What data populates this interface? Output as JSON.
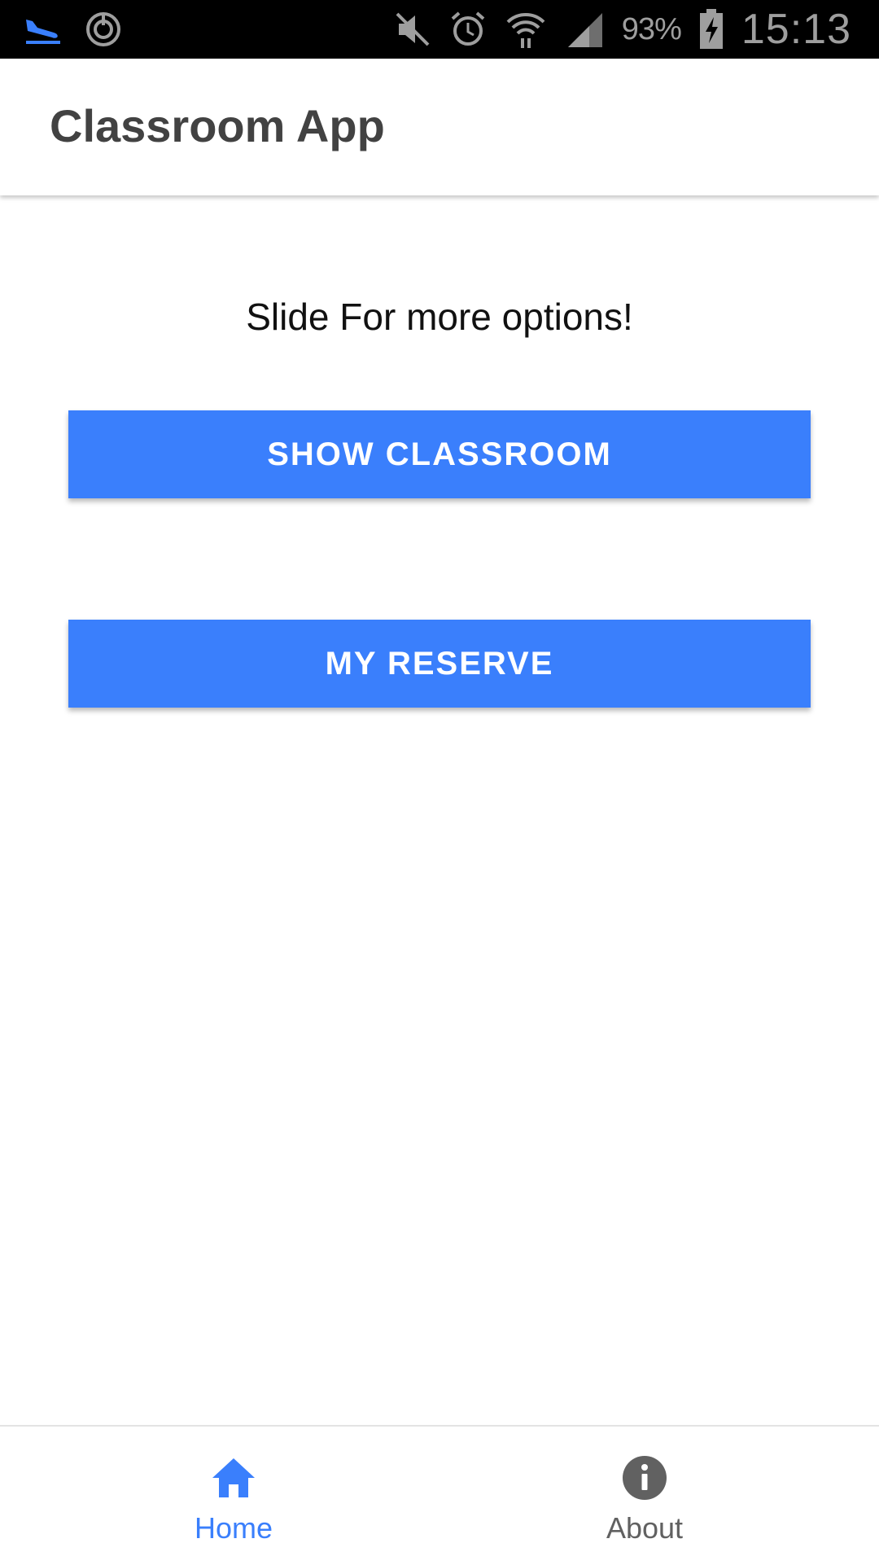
{
  "status_bar": {
    "battery_percent": "93%",
    "time": "15:13",
    "icons": [
      "airplane-landing-icon",
      "sync-icon",
      "mute-icon",
      "alarm-icon",
      "wifi-icon",
      "signal-icon",
      "battery-charging-icon"
    ]
  },
  "app_bar": {
    "title": "Classroom App"
  },
  "main": {
    "subtitle": "Slide For more options!",
    "show_classroom_label": "SHOW CLASSROOM",
    "my_reserve_label": "MY RESERVE"
  },
  "bottom_nav": {
    "items": [
      {
        "label": "Home",
        "icon": "home-icon",
        "active": true
      },
      {
        "label": "About",
        "icon": "info-icon",
        "active": false
      }
    ]
  },
  "colors": {
    "accent": "#3a7ffc",
    "status_bar_bg": "#000000",
    "title_text": "#424242",
    "inactive_nav": "#616161"
  }
}
